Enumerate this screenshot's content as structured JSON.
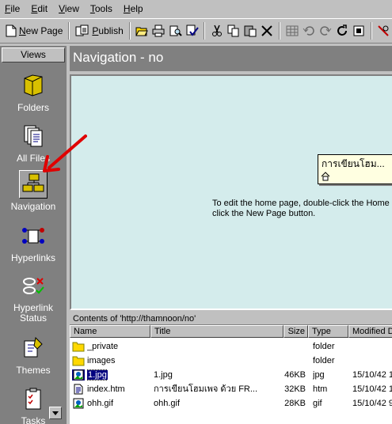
{
  "menu": [
    {
      "pre": "",
      "ul": "F",
      "post": "ile"
    },
    {
      "pre": "",
      "ul": "E",
      "post": "dit"
    },
    {
      "pre": "",
      "ul": "V",
      "post": "iew"
    },
    {
      "pre": "",
      "ul": "T",
      "post": "ools"
    },
    {
      "pre": "",
      "ul": "H",
      "post": "elp"
    }
  ],
  "toolbar": {
    "new_page": {
      "ul": "N",
      "rest": "ew Page"
    },
    "publish": {
      "ul": "P",
      "rest": "ublish"
    }
  },
  "views": {
    "header": "Views",
    "items": [
      {
        "label": "Folders",
        "icon": "folder-icon"
      },
      {
        "label": "All Files",
        "icon": "all-files-icon"
      },
      {
        "label": "Navigation",
        "icon": "navigation-icon"
      },
      {
        "label": "Hyperlinks",
        "icon": "hyperlinks-icon"
      },
      {
        "label": "Hyperlink\nStatus",
        "icon": "hyperlink-status-icon"
      },
      {
        "label": "Themes",
        "icon": "themes-icon"
      },
      {
        "label": "Tasks",
        "icon": "tasks-icon"
      }
    ]
  },
  "main": {
    "title": "Navigation - no",
    "page_box_title": "การเขียนโฮม...",
    "hint": "To edit the home page, double-click the Home P\nclick the New Page button."
  },
  "contents": {
    "caption": "Contents of 'http://thamnoon/no'",
    "columns": [
      "Name",
      "Title",
      "Size",
      "Type",
      "Modified D"
    ],
    "rows": [
      {
        "icon": "folder-icon",
        "name": "_private",
        "title": "",
        "size": "",
        "type": "folder",
        "modified": ""
      },
      {
        "icon": "folder-icon",
        "name": "images",
        "title": "",
        "size": "",
        "type": "folder",
        "modified": ""
      },
      {
        "icon": "image-file-icon",
        "name": "1.jpg",
        "title": "1.jpg",
        "size": "46KB",
        "type": "jpg",
        "modified": "15/10/42 1",
        "selected": true
      },
      {
        "icon": "html-file-icon",
        "name": "index.htm",
        "title": "การเขียนโฮมเพจ ด้วย FR...",
        "size": "32KB",
        "type": "htm",
        "modified": "15/10/42 1"
      },
      {
        "icon": "image-file-icon",
        "name": "ohh.gif",
        "title": "ohh.gif",
        "size": "28KB",
        "type": "gif",
        "modified": "15/10/42 9"
      }
    ]
  },
  "colors": {
    "accent": "#000080",
    "nav_bg": "#d4ecec",
    "annotation_arrow": "#e00000"
  }
}
